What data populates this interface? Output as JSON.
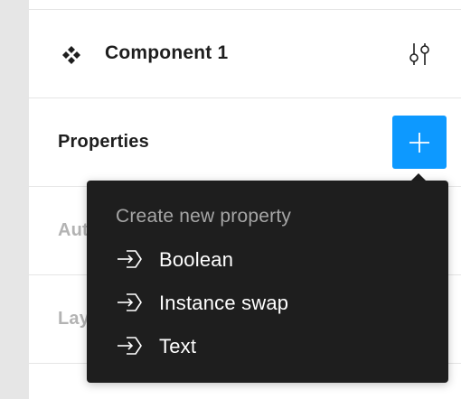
{
  "component": {
    "name": "Component 1",
    "icon": "component-icon",
    "settings_icon": "adjust-sliders-icon"
  },
  "sections": {
    "properties": {
      "title": "Properties",
      "add_icon": "plus-icon"
    },
    "auto_layout": {
      "title": "Auto layout"
    },
    "layer": {
      "title": "Layer"
    }
  },
  "menu": {
    "header": "Create new property",
    "items": [
      {
        "label": "Boolean",
        "icon": "property-enter-icon"
      },
      {
        "label": "Instance swap",
        "icon": "property-enter-icon"
      },
      {
        "label": "Text",
        "icon": "property-enter-icon"
      }
    ]
  },
  "colors": {
    "accent": "#0d99ff",
    "menu_bg": "#1e1e1e",
    "gutter": "#e6e6e6"
  }
}
